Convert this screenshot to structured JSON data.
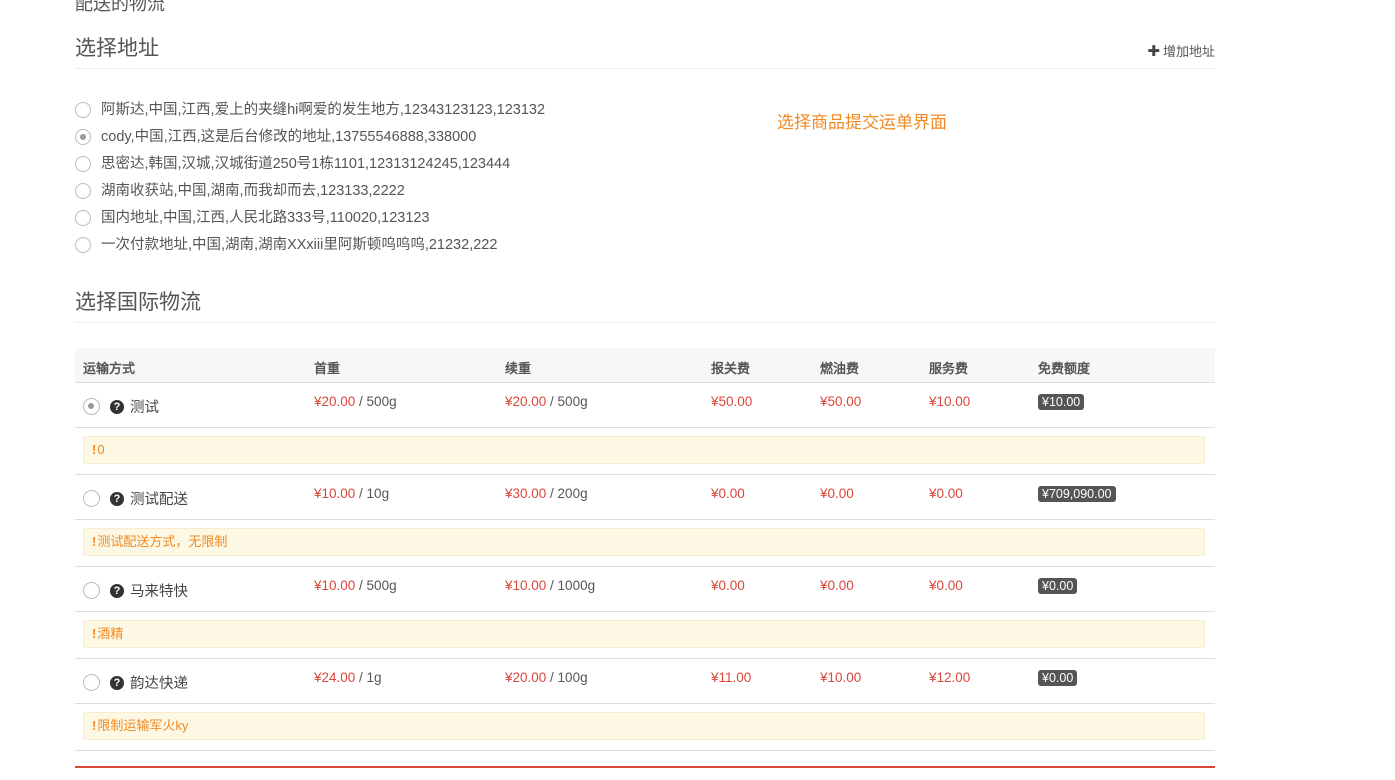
{
  "top_cut_title": "配送的物流",
  "address_section": {
    "title": "选择地址",
    "add_label": "增加地址",
    "addresses": [
      {
        "text": "阿斯达,中国,江西,爱上的夹缝hi啊爱的发生地方,12343123123,123132",
        "checked": false
      },
      {
        "text": "cody,中国,江西,这是后台修改的地址,13755546888,338000",
        "checked": true
      },
      {
        "text": "思密达,韩国,汉城,汉城街道250号1栋1101,12313124245,123444",
        "checked": false
      },
      {
        "text": "湖南收获站,中国,湖南,而我却而去,123133,2222",
        "checked": false
      },
      {
        "text": "国内地址,中国,江西,人民北路333号,110020,123123",
        "checked": false
      },
      {
        "text": "一次付款地址,中国,湖南,湖南XXxiii里阿斯顿呜呜呜,21232,222",
        "checked": false
      }
    ]
  },
  "notice": "选择商品提交运单界面",
  "logistics_section": {
    "title": "选择国际物流",
    "headers": {
      "method": "运输方式",
      "first_weight": "首重",
      "continued_weight": "续重",
      "customs_fee": "报关费",
      "fuel_fee": "燃油费",
      "service_fee": "服务费",
      "free_quota": "免费额度"
    },
    "rows": [
      {
        "name": "测试",
        "checked": true,
        "first_price": "¥20.00",
        "first_unit": " / 500g",
        "cont_price": "¥20.00",
        "cont_unit": " / 500g",
        "customs": "¥50.00",
        "fuel": "¥50.00",
        "service": "¥10.00",
        "free": "¥10.00",
        "note": "0"
      },
      {
        "name": "测试配送",
        "checked": false,
        "first_price": "¥10.00",
        "first_unit": " / 10g",
        "cont_price": "¥30.00",
        "cont_unit": " / 200g",
        "customs": "¥0.00",
        "fuel": "¥0.00",
        "service": "¥0.00",
        "free": "¥709,090.00",
        "note": "测试配送方式，无限制"
      },
      {
        "name": "马来特快",
        "checked": false,
        "first_price": "¥10.00",
        "first_unit": " / 500g",
        "cont_price": "¥10.00",
        "cont_unit": " / 1000g",
        "customs": "¥0.00",
        "fuel": "¥0.00",
        "service": "¥0.00",
        "free": "¥0.00",
        "note": "酒精"
      },
      {
        "name": "韵达快递",
        "checked": false,
        "first_price": "¥24.00",
        "first_unit": " / 1g",
        "cont_price": "¥20.00",
        "cont_unit": " / 100g",
        "customs": "¥11.00",
        "fuel": "¥10.00",
        "service": "¥12.00",
        "free": "¥0.00",
        "note": "限制运输军火ky"
      }
    ]
  },
  "icons": {
    "add": "plus-icon",
    "help": "question-circle-icon",
    "note": "exclamation-icon"
  },
  "colors": {
    "price": "#d9463a",
    "notice": "#f08a24",
    "note_bg": "#fcf8e3",
    "badge_bg": "#555555"
  }
}
